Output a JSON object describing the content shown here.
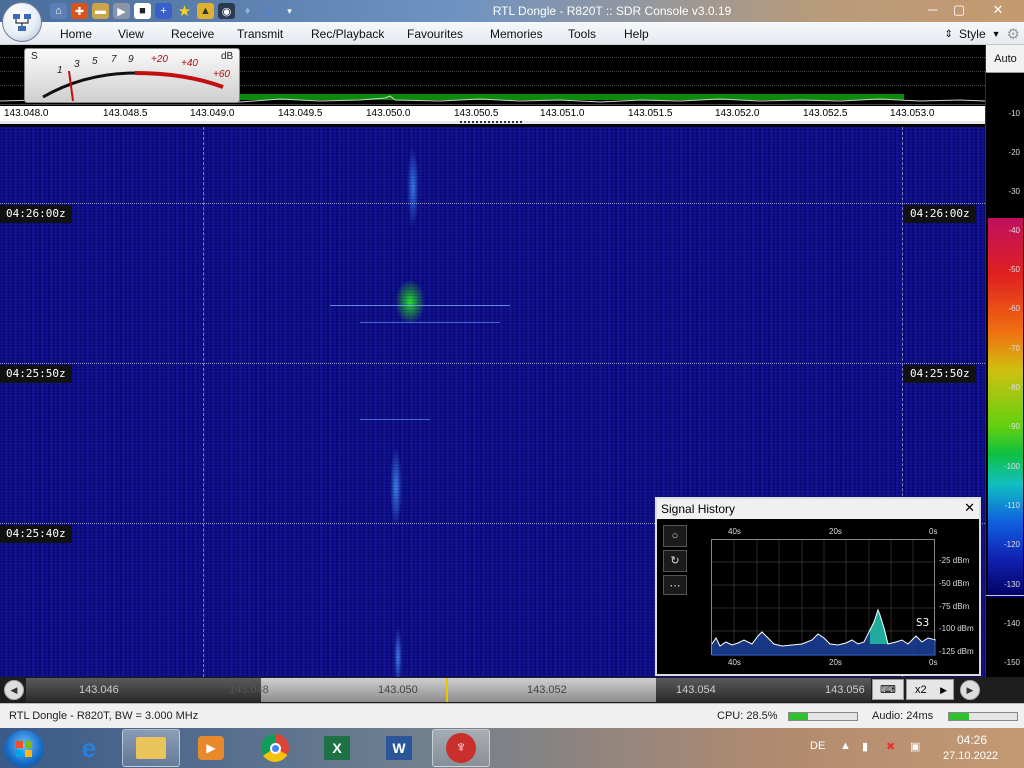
{
  "window": {
    "title": "RTL Dongle - R820T :: SDR Console v3.0.19",
    "minimize": "─",
    "maximize": "▢",
    "close": "✕"
  },
  "quick_access": [
    "home-icon",
    "help-ring-icon",
    "folder-icon",
    "play-icon",
    "stop-icon",
    "plus-icon",
    "star-icon",
    "lock-icon",
    "camera-icon",
    "drop-icon",
    "undo-icon",
    "dropdown-icon"
  ],
  "menu": {
    "items": [
      "Home",
      "View",
      "Receive",
      "Transmit",
      "Rec/Playback",
      "Favourites",
      "Memories",
      "Tools",
      "Help"
    ],
    "style_label": "Style"
  },
  "smeter": {
    "s_label": "S",
    "db_label": "dB",
    "ticks": [
      "1",
      "3",
      "5",
      "7",
      "9",
      "+20",
      "+40",
      "+60"
    ]
  },
  "freq_scale": [
    "143.048.0",
    "143.048.5",
    "143.049.0",
    "143.049.5",
    "143.050.0",
    "143.050.5",
    "143.051.0",
    "143.051.5",
    "143.052.0",
    "143.052.5",
    "143.053.0"
  ],
  "waterfall": {
    "time_labels": [
      "04:26:00z",
      "04:25:50z",
      "04:25:40z"
    ]
  },
  "db_scale": {
    "auto_label": "Auto",
    "labels": [
      "-10",
      "-20",
      "-30",
      "-40",
      "-50",
      "-60",
      "-70",
      "-80",
      "-90",
      "-100",
      "-110",
      "-120",
      "-130",
      "-140",
      "-150"
    ]
  },
  "signal_history": {
    "title": "Signal History",
    "close": "✕",
    "buttons": [
      "○",
      "↻",
      "⋯"
    ],
    "x_top": [
      "40s",
      "20s",
      "0s"
    ],
    "x_bottom": [
      "40s",
      "20s",
      "0s"
    ],
    "y_labels": [
      "-25 dBm",
      "-50 dBm",
      "-75 dBm",
      "-100 dBm",
      "-125 dBm"
    ],
    "s_reading": "S3"
  },
  "tuner": {
    "ticks": [
      "143.046",
      "143.048",
      "143.050",
      "143.052",
      "143.054",
      "143.056"
    ],
    "zoom_label": "x2"
  },
  "status": {
    "device": "RTL Dongle - R820T, BW = 3.000 MHz",
    "cpu": "CPU: 28.5%",
    "cpu_fraction": 0.285,
    "audio": "Audio: 24ms",
    "audio_fraction": 0.3
  },
  "taskbar": {
    "apps": [
      "ie-icon",
      "explorer-icon",
      "media-player-icon",
      "chrome-icon",
      "excel-icon",
      "word-icon",
      "sdr-console-icon"
    ],
    "lang": "DE",
    "time": "04:26",
    "date": "27.10.2022"
  }
}
